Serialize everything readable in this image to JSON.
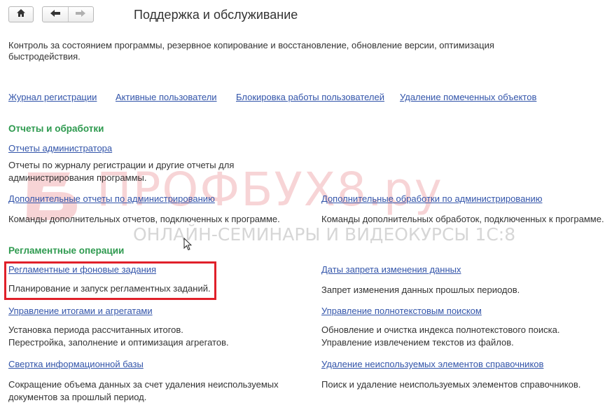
{
  "header": {
    "title": "Поддержка и обслуживание",
    "description": "Контроль за состоянием программы, резервное копирование и восстановление, обновление версии, оптимизация быстродействия."
  },
  "top_links": [
    {
      "label": "Журнал регистрации"
    },
    {
      "label": "Активные пользователи"
    },
    {
      "label": "Блокировка работы пользователей"
    },
    {
      "label": "Удаление помеченных объектов"
    }
  ],
  "sections": {
    "reports": {
      "heading": "Отчеты и обработки",
      "items": [
        {
          "link": "Отчеты администратора",
          "desc": "Отчеты по журналу регистрации и другие отчеты для\nадминистрирования программы."
        },
        {
          "link": "Дополнительные отчеты по администрированию",
          "desc": "Команды дополнительных отчетов, подключенных к программе."
        },
        {
          "link": "Дополнительные обработки по администрированию",
          "desc": "Команды дополнительных обработок, подключенных к программе."
        }
      ]
    },
    "scheduled": {
      "heading": "Регламентные операции",
      "items": [
        {
          "link": "Регламентные и фоновые задания",
          "desc": "Планирование и запуск регламентных заданий."
        },
        {
          "link": "Даты запрета изменения данных",
          "desc": "Запрет изменения данных прошлых периодов."
        },
        {
          "link": "Управление итогами и агрегатами",
          "desc": "Установка периода рассчитанных итогов.\nПерестройка, заполнение и оптимизация агрегатов."
        },
        {
          "link": "Управление полнотекстовым поиском",
          "desc": "Обновление и очистка индекса полнотекстового поиска.\nУправление извлечением текстов из файлов."
        },
        {
          "link": "Свертка информационной базы",
          "desc": "Сокращение объема данных за счет удаления неиспользуемых\nдокументов за прошлый период."
        },
        {
          "link": "Удаление неиспользуемых элементов справочников",
          "desc": "Поиск и удаление неиспользуемых элементов справочников."
        }
      ]
    }
  },
  "watermark": {
    "main": "ПРОФБУХ8.ру",
    "sub": "ОНЛАЙН-СЕМИНАРЫ И ВИДЕОКУРСЫ 1С:8"
  },
  "colors": {
    "link": "#3355aa",
    "heading": "#2e9a4f",
    "highlight": "#e0202a"
  },
  "icons": [
    "home-icon",
    "back-arrow-icon",
    "forward-arrow-icon",
    "mouse-cursor-icon"
  ]
}
